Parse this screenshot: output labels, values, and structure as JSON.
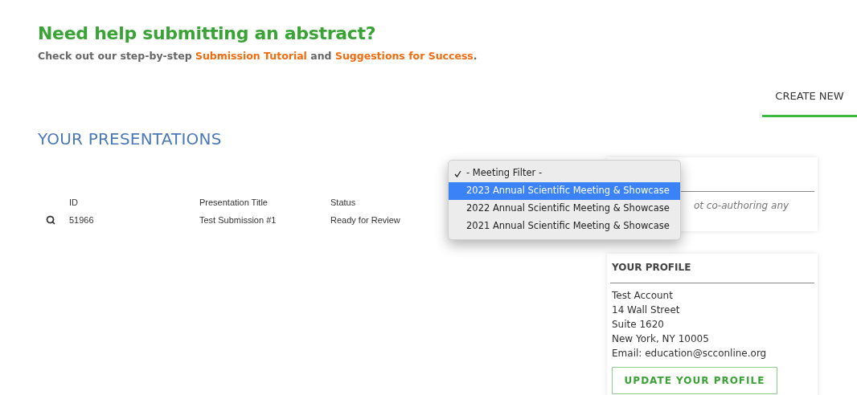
{
  "help": {
    "title": "Need help submitting an abstract?",
    "links": [
      "Submission Tutorial",
      "Suggestions for Success"
    ],
    "lead": "Check out our step-by-step",
    "joiner": "and",
    "end": "."
  },
  "create_tab": {
    "label": "CREATE NEW",
    "selected": true
  },
  "section_title": "YOUR PRESENTATIONS",
  "table": {
    "columns": [
      "ID",
      "Presentation Title",
      "Status"
    ],
    "rows": [
      {
        "cells": [
          "51966",
          "Test Submission #1",
          "Ready for Review"
        ]
      }
    ]
  },
  "coauthor_card": {
    "text": "ot co-authoring any"
  },
  "profile": {
    "title": "YOUR PROFILE",
    "lines": [
      "Test Account",
      "14 Wall Street",
      "Suite 1620",
      "New York, NY 10005",
      "Email: education@scconline.org"
    ],
    "button": "UPDATE YOUR PROFILE"
  },
  "dropdown": {
    "items": [
      {
        "label": "- Meeting Filter -",
        "checked": true,
        "selected": false
      },
      {
        "label": "2023 Annual Scientific Meeting & Showcase",
        "checked": false,
        "selected": true
      },
      {
        "label": "2022 Annual Scientific Meeting & Showcase",
        "checked": false,
        "selected": false
      },
      {
        "label": "2021 Annual Scientific Meeting & Showcase",
        "checked": false,
        "selected": false
      }
    ]
  }
}
